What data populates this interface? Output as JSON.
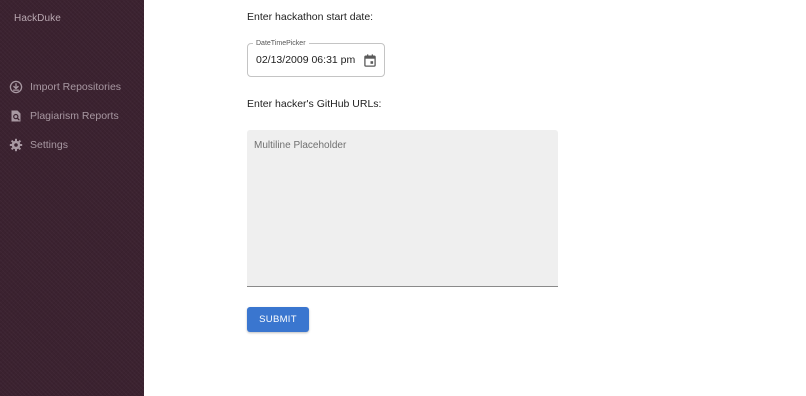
{
  "app": {
    "title": "HackDuke"
  },
  "sidebar": {
    "items": [
      {
        "label": "Import Repositories",
        "icon": "import-icon"
      },
      {
        "label": "Plagiarism Reports",
        "icon": "report-search-icon"
      },
      {
        "label": "Settings",
        "icon": "gear-icon"
      }
    ]
  },
  "form": {
    "start_date_label": "Enter hackathon start date:",
    "datetime_picker": {
      "legend": "DateTimePicker",
      "value": "02/13/2009 06:31 pm",
      "icon": "calendar-icon"
    },
    "urls_label": "Enter hacker's GitHub URLs:",
    "urls_textarea": {
      "placeholder": "Multiline Placeholder",
      "value": ""
    },
    "submit_label": "SUBMIT"
  },
  "colors": {
    "sidebar_bg": "#3b2230",
    "sidebar_text": "#a898a2",
    "primary": "#3a76cf",
    "textarea_bg": "#efefef"
  }
}
